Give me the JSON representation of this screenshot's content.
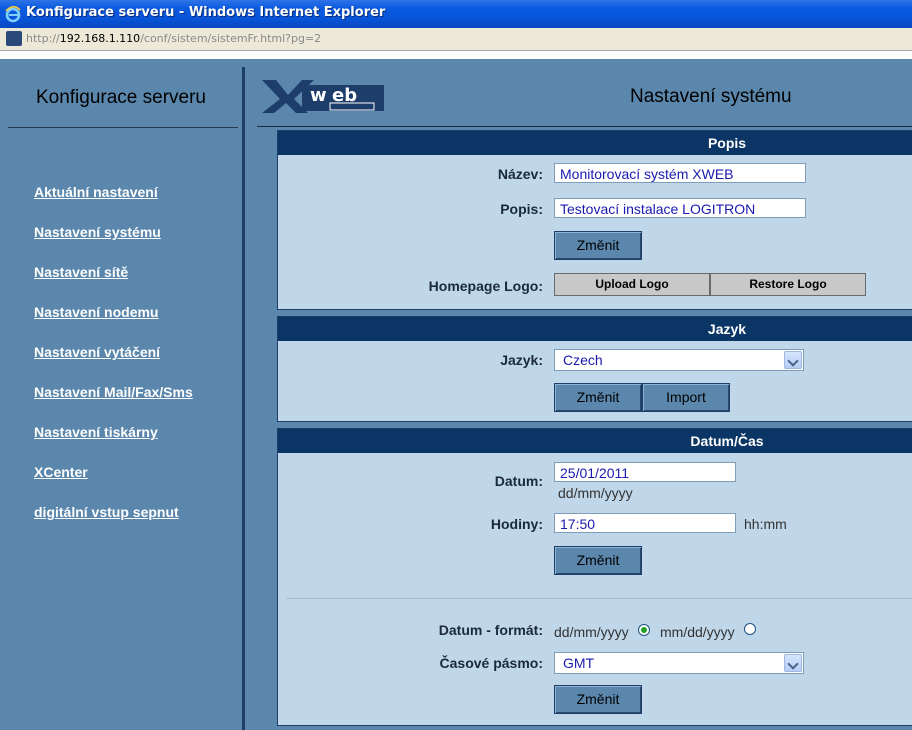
{
  "window": {
    "title": "Konfigurace serveru - Windows Internet Explorer"
  },
  "address": {
    "scheme": "http://",
    "host": "192.168.1.110",
    "path": "/conf/sistem/sistemFr.html?pg=2"
  },
  "sidebar": {
    "title": "Konfigurace serveru",
    "items": [
      {
        "label": "Aktuální nastavení"
      },
      {
        "label": "Nastavení systému"
      },
      {
        "label": "Nastavení sítě"
      },
      {
        "label": "Nastavení nodemu"
      },
      {
        "label": "Nastavení vytáčení"
      },
      {
        "label": "Nastavení Mail/Fax/Sms"
      },
      {
        "label": "Nastavení tiskárny"
      },
      {
        "label": "XCenter"
      },
      {
        "label": "digitální vstup sepnut"
      }
    ]
  },
  "main": {
    "page_title": "Nastavení systému",
    "logo_alt": "XWeb 500",
    "popis": {
      "header": "Popis",
      "name_label": "Název:",
      "name_value": "Monitorovací systém XWEB",
      "desc_label": "Popis:",
      "desc_value": "Testovací instalace LOGITRON",
      "change_label": "Změnit",
      "logo_label": "Homepage Logo:",
      "upload_label": "Upload Logo",
      "restore_label": "Restore Logo"
    },
    "jazyk": {
      "header": "Jazyk",
      "label": "Jazyk:",
      "value": "Czech",
      "change_label": "Změnit",
      "import_label": "Import"
    },
    "datetime": {
      "header": "Datum/Čas",
      "date_label": "Datum:",
      "date_value": "25/01/2011",
      "date_hint": "dd/mm/yyyy",
      "time_label": "Hodiny:",
      "time_value": "17:50",
      "time_hint": "hh:mm",
      "change_label": "Změnit",
      "format_label": "Datum - formát:",
      "format_opt1": "dd/mm/yyyy",
      "format_opt2": "mm/dd/yyyy",
      "format_selected": "dd/mm/yyyy",
      "tz_label": "Časové pásmo:",
      "tz_value": "GMT",
      "change2_label": "Změnit"
    }
  }
}
